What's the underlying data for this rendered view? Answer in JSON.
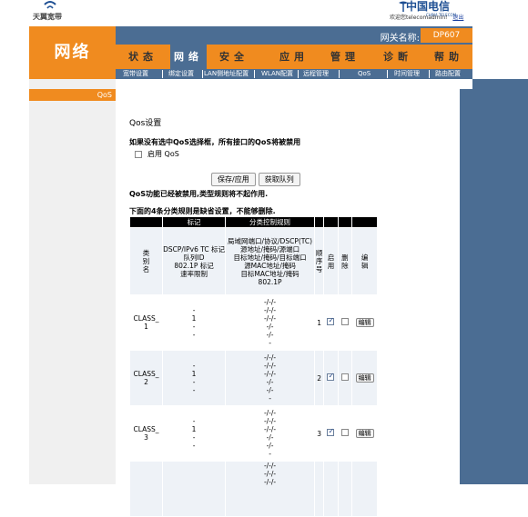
{
  "header": {
    "left_logo_text": "天翼宽带",
    "right_logo_cn": "中国电信",
    "right_logo_en": "CHINA TELECOM",
    "welcome": "欢迎您telecomadmin!",
    "logout": "退出",
    "section_title": "网络",
    "gateway_label": "网关名称:",
    "gateway_value": "DP607"
  },
  "menu": [
    {
      "label": "状态",
      "active": false
    },
    {
      "label": "网络",
      "active": true
    },
    {
      "label": "安全",
      "active": false
    },
    {
      "label": "应用",
      "active": false
    },
    {
      "label": "管理",
      "active": false
    },
    {
      "label": "诊断",
      "active": false
    },
    {
      "label": "帮助",
      "active": false
    }
  ],
  "submenu": [
    "宽带设置",
    "绑定设置",
    "LAN侧地址配置",
    "WLAN配置",
    "远程管理",
    "QoS",
    "时间管理",
    "路由配置"
  ],
  "sidebar": {
    "active_item": "QoS"
  },
  "content": {
    "title": "Qos设置",
    "warning": "如果没有选中QoS选择框，所有接口的QoS将被禁用",
    "enable_label": "启用 QoS",
    "enable_checked": false,
    "save_button": "保存/应用",
    "get_queue_button": "获取队列",
    "disabled_notice": "QoS功能已经被禁用,类型规则将不起作用.",
    "default_rules_notice": "下面的4条分类规则是缺省设置，不能够删除."
  },
  "table": {
    "top_headers": [
      "",
      "标记",
      "分类控制规则",
      "",
      "",
      "",
      ""
    ],
    "col_headers": {
      "name": "类别名",
      "mark": [
        "DSCP/IPv6 TC 标记",
        "队列ID",
        "802.1P 标记",
        "速率限制"
      ],
      "rules": [
        "局域网端口/协议/DSCP(TC)",
        "源地址/掩码/源端口",
        "目标地址/掩码/目标端口",
        "源MAC地址/掩码",
        "目标MAC地址/掩码",
        "802.1P"
      ],
      "order": "顺序号",
      "enable": "启用",
      "delete": "删除",
      "edit": "编辑"
    },
    "rows": [
      {
        "name": "CLASS_1",
        "mark": [
          "-",
          "1",
          "-",
          "-"
        ],
        "rules": [
          "-/-/-",
          "-/-/-",
          "-/-/-",
          "-/-",
          "-/-",
          "-"
        ],
        "order": "1",
        "enabled": true,
        "delete": false,
        "edit_label": "编辑"
      },
      {
        "name": "CLASS_2",
        "mark": [
          "-",
          "1",
          "-",
          "-"
        ],
        "rules": [
          "-/-/-",
          "-/-/-",
          "-/-/-",
          "-/-",
          "-/-",
          "-"
        ],
        "order": "2",
        "enabled": true,
        "delete": false,
        "edit_label": "编辑"
      },
      {
        "name": "CLASS_3",
        "mark": [
          "-",
          "1",
          "-",
          "-"
        ],
        "rules": [
          "-/-/-",
          "-/-/-",
          "-/-/-",
          "-/-",
          "-/-",
          "-"
        ],
        "order": "3",
        "enabled": true,
        "delete": false,
        "edit_label": "编辑"
      },
      {
        "name": "",
        "mark": [],
        "rules": [
          "-/-/-",
          "-/-/-",
          "-/-/-"
        ],
        "order": "",
        "enabled": false,
        "delete": false,
        "edit_label": ""
      }
    ]
  },
  "colors": {
    "orange": "#f08b1f",
    "blue": "#4b6d93",
    "row_bg": "#eef2f7"
  }
}
